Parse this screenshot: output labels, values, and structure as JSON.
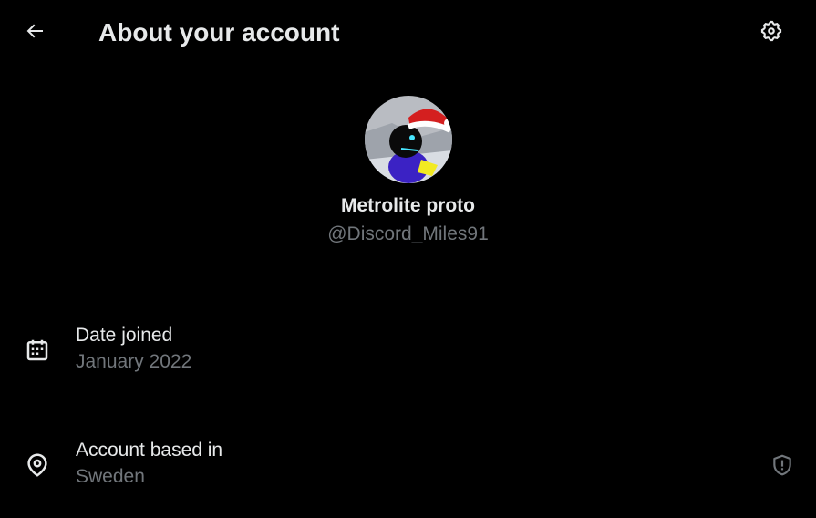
{
  "header": {
    "back_icon": "arrow-left-icon",
    "title": "About your account",
    "settings_icon": "gear-icon"
  },
  "profile": {
    "display_name": "Metrolite proto",
    "handle": "@Discord_Miles91",
    "avatar_icon": "avatar-image"
  },
  "details": {
    "date_joined": {
      "icon": "calendar-icon",
      "label": "Date joined",
      "value": "January 2022"
    },
    "country": {
      "icon": "location-pin-icon",
      "label": "Account based in",
      "value": "Sweden",
      "badge_icon": "shield-info-icon"
    }
  },
  "colors": {
    "background": "#000000",
    "primary_text": "#e7e9ea",
    "secondary_text": "#71767b"
  }
}
